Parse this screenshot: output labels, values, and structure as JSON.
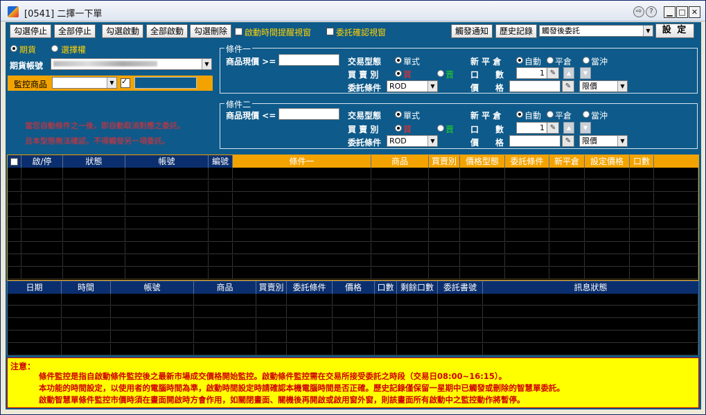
{
  "window": {
    "title": "[0541] 二擇一下單"
  },
  "toolbar": {
    "buttons": [
      "勾選停止",
      "全部停止",
      "勾選啟動",
      "全部啟動",
      "勾選刪除"
    ],
    "chk_time_prompt": "啟動時間提醒視窗",
    "chk_order_confirm": "委託確認視窗",
    "trigger_notice": "觸發通知",
    "history": "歷史記錄",
    "after_trigger_select": "觸發後委託",
    "settings": "設 定"
  },
  "left": {
    "radio_futures": "期貨",
    "radio_options": "選擇權",
    "account_label": "期貨帳號",
    "account_value": "",
    "monitor_label": "監控商品",
    "warn1": "當您自動條件之一後，即自動取消對應之委託。",
    "warn2": "且本型態無法確認，不得觸發另一項委託。"
  },
  "cond1": {
    "legend": "條件一",
    "price_label": "商品現價 >=",
    "trade_type_label": "交易型態",
    "trade_type_value": "單式",
    "new_close_label": "新 平 倉",
    "nc_auto": "自動",
    "nc_close": "平倉",
    "nc_daytrade": "當沖",
    "side_label": "買 賣 別",
    "side_buy": "買",
    "side_sell": "賣",
    "qty_label": "口　　數",
    "qty_value": "1",
    "order_cond_label": "委託條件",
    "order_cond_value": "ROD",
    "price2_label": "價　　格",
    "price_type_value": "限價"
  },
  "cond2": {
    "legend": "條件二",
    "price_label": "商品現價 <=",
    "trade_type_label": "交易型態",
    "trade_type_value": "單式",
    "new_close_label": "新 平 倉",
    "nc_auto": "自動",
    "nc_close": "平倉",
    "nc_daytrade": "當沖",
    "side_label": "買 賣 別",
    "side_buy": "買",
    "side_sell": "賣",
    "qty_label": "口　　數",
    "qty_value": "1",
    "order_cond_label": "委託條件",
    "order_cond_value": "ROD",
    "price2_label": "價　　格",
    "price_type_value": "限價"
  },
  "grid1": {
    "columns": [
      "",
      "啟/停",
      "狀態",
      "帳號",
      "編號",
      "條件一",
      "商品",
      "買賣別",
      "價格型態",
      "委託條件",
      "新平倉",
      "設定價格",
      "口數"
    ]
  },
  "grid2": {
    "columns": [
      "日期",
      "時間",
      "帳號",
      "商品",
      "買賣別",
      "委託條件",
      "價格",
      "口數",
      "剩餘口數",
      "委託書號",
      "訊息狀態"
    ]
  },
  "notice": {
    "title": "注意：",
    "line1": "條件監控是指自啟動條件監控後之最新市場成交價格開始監控。啟動條件監控需在交易所接受委託之時段（交易日08:00~16:15）。",
    "line2": "本功能的時間設定，以使用者的電腦時間為準，啟動時間設定時請確認本機電腦時間是否正確。歷史記錄僅保留一星期中已觸發或刪除的智慧單委託。",
    "line3": "啟動智慧單條件監控市價時須在畫面開啟時方會作用，如關閉畫面、關機後再開啟或啟用窗外窗，則該畫面所有啟動中之監控動作將暫停。"
  },
  "colors": {
    "panel": "#0e5a8a",
    "accent": "#f3a300",
    "notice_bg": "#ffff00",
    "notice_text": "#d00000"
  }
}
